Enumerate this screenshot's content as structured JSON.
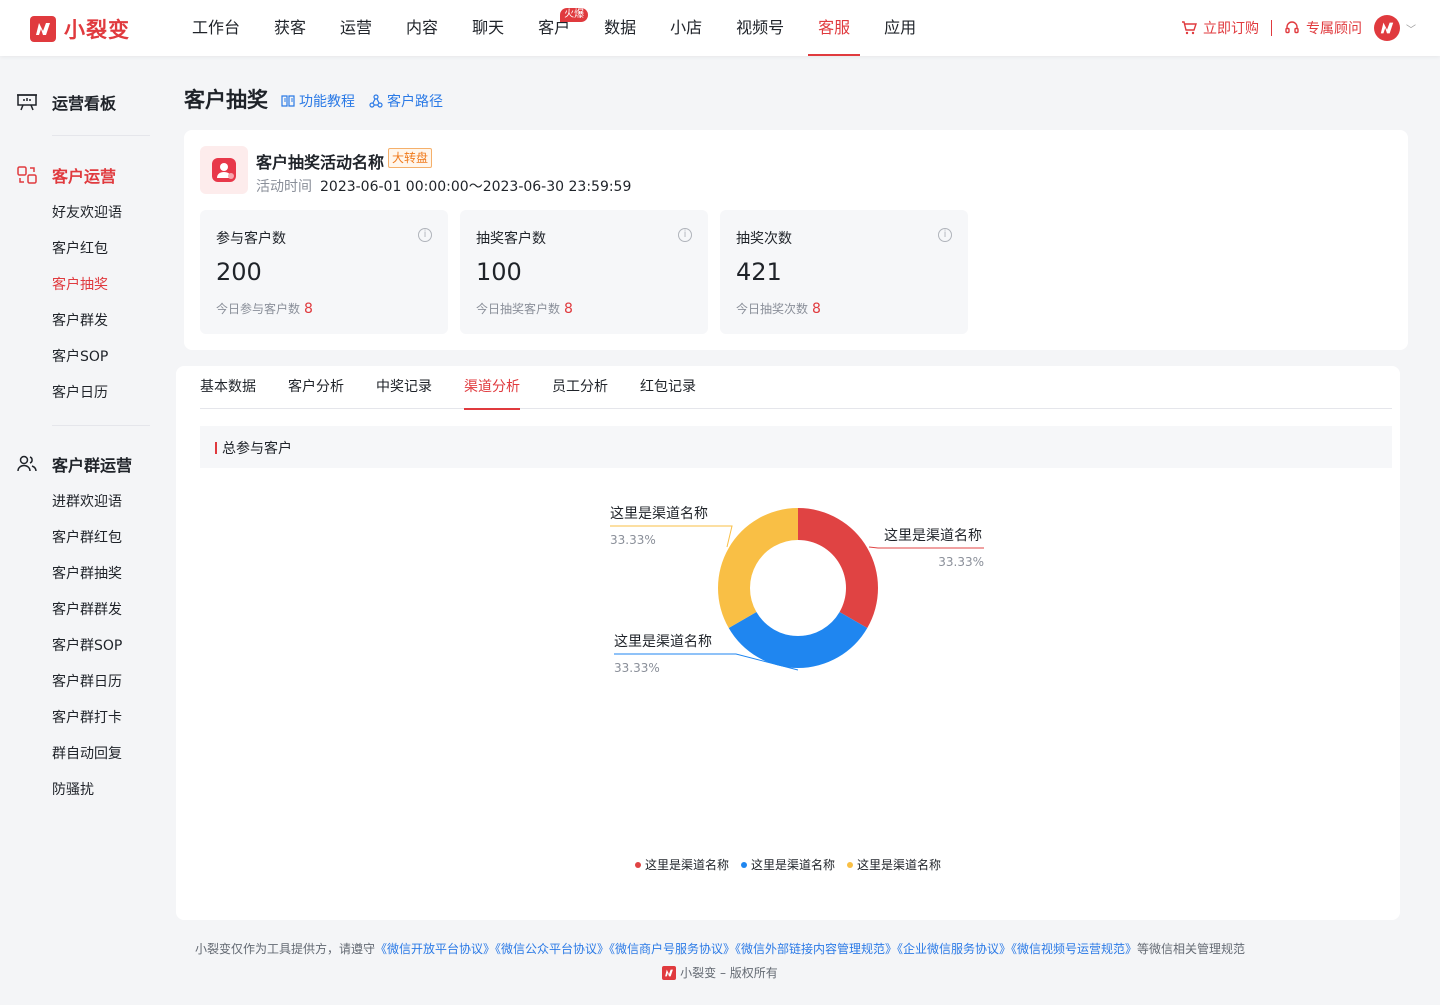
{
  "brand": {
    "name": "小裂变",
    "color": "#e03a3e"
  },
  "nav": {
    "items": [
      {
        "label": "工作台"
      },
      {
        "label": "获客"
      },
      {
        "label": "运营"
      },
      {
        "label": "内容"
      },
      {
        "label": "聊天"
      },
      {
        "label": "客户",
        "badge": "火爆"
      },
      {
        "label": "数据"
      },
      {
        "label": "小店"
      },
      {
        "label": "视频号"
      },
      {
        "label": "客服",
        "active": true
      },
      {
        "label": "应用"
      }
    ],
    "order_label": "立即订购",
    "advisor_label": "专属顾问"
  },
  "sidebar": {
    "dashboard": "运营看板",
    "group1": {
      "title": "客户运营",
      "items": [
        "好友欢迎语",
        "客户红包",
        "客户抽奖",
        "客户群发",
        "客户SOP",
        "客户日历"
      ]
    },
    "group2": {
      "title": "客户群运营",
      "items": [
        "进群欢迎语",
        "客户群红包",
        "客户群抽奖",
        "客户群群发",
        "客户群SOP",
        "客户群日历",
        "客户群打卡",
        "群自动回复",
        "防骚扰"
      ]
    },
    "active_item": "客户抽奖"
  },
  "page": {
    "title": "客户抽奖",
    "tutorial_link": "功能教程",
    "path_link": "客户路径"
  },
  "activity": {
    "name": "客户抽奖活动名称",
    "tag": "大转盘",
    "time_label": "活动时间",
    "time_value": "2023-06-01 00:00:00～2023-06-30 23:59:59"
  },
  "stats": [
    {
      "label": "参与客户数",
      "value": "200",
      "sub_label": "今日参与客户数",
      "sub_value": "8"
    },
    {
      "label": "抽奖客户数",
      "value": "100",
      "sub_label": "今日抽奖客户数",
      "sub_value": "8"
    },
    {
      "label": "抽奖次数",
      "value": "421",
      "sub_label": "今日抽奖次数",
      "sub_value": "8"
    }
  ],
  "tabs": [
    {
      "label": "基本数据"
    },
    {
      "label": "客户分析"
    },
    {
      "label": "中奖记录"
    },
    {
      "label": "渠道分析",
      "active": true
    },
    {
      "label": "员工分析"
    },
    {
      "label": "红包记录"
    }
  ],
  "section_title": "总参与客户",
  "chart_data": {
    "type": "pie",
    "donut": true,
    "categories": [
      "这里是渠道名称",
      "这里是渠道名称",
      "这里是渠道名称"
    ],
    "values": [
      33.33,
      33.33,
      33.33
    ],
    "labels": [
      "33.33%",
      "33.33%",
      "33.33%"
    ],
    "colors": [
      "#e04343",
      "#1f86f0",
      "#f9bf45"
    ],
    "legend": "bottom-center"
  },
  "footer": {
    "prefix": "小裂变仅作为工具提供方，请遵守",
    "links": [
      "《微信开放平台协议》",
      "《微信公众平台协议》",
      "《微信商户号服务协议》",
      "《微信外部链接内容管理规范》",
      "《企业微信服务协议》",
      "《微信视频号运营规范》"
    ],
    "suffix": "等微信相关管理规范",
    "copyright": "小裂变 – 版权所有"
  }
}
